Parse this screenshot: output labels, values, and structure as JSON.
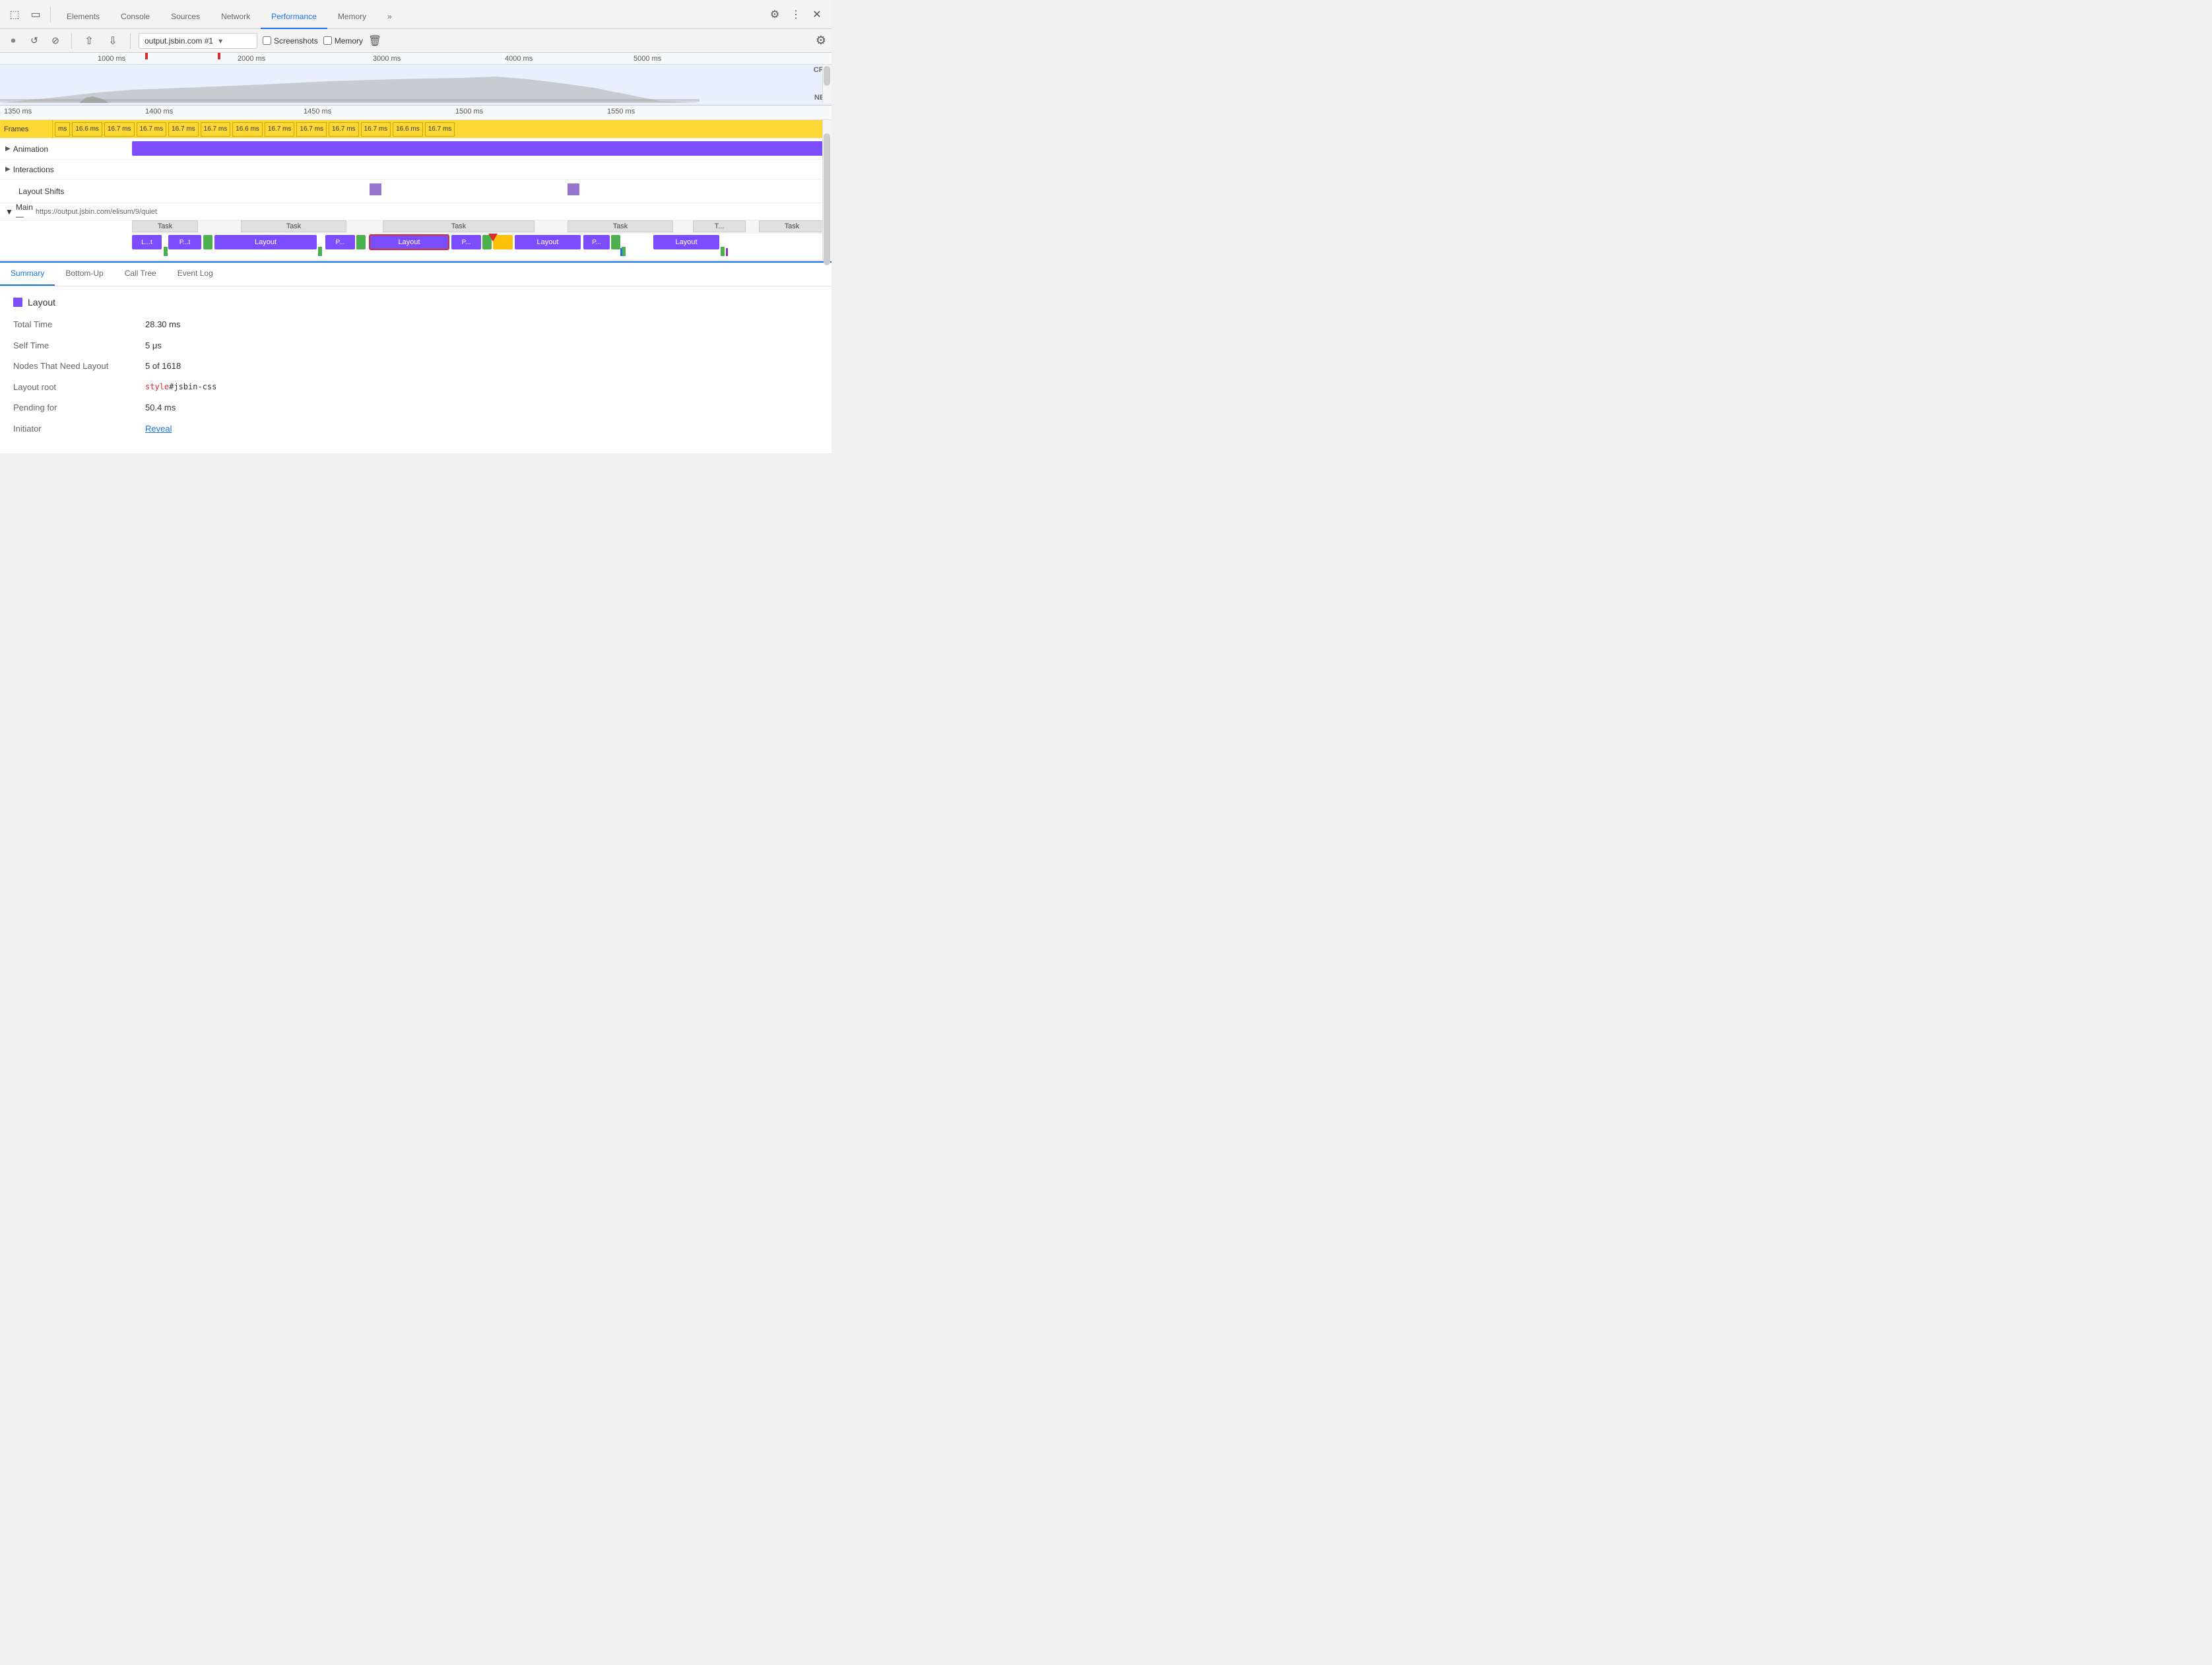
{
  "tabs": {
    "items": [
      {
        "label": "Elements",
        "active": false
      },
      {
        "label": "Console",
        "active": false
      },
      {
        "label": "Sources",
        "active": false
      },
      {
        "label": "Network",
        "active": false
      },
      {
        "label": "Performance",
        "active": true
      },
      {
        "label": "Memory",
        "active": false
      },
      {
        "label": "»",
        "active": false
      }
    ]
  },
  "record_bar": {
    "url": "output.jsbin.com #1",
    "screenshots_label": "Screenshots",
    "memory_label": "Memory"
  },
  "overview": {
    "time_markers": [
      "1000 ms",
      "2000 ms",
      "3000 ms",
      "4000 ms",
      "5000 ms"
    ],
    "cpu_label": "CPU",
    "net_label": "NET"
  },
  "detail": {
    "time_markers": [
      "1350 ms",
      "1400 ms",
      "1450 ms",
      "1500 ms",
      "1550 ms"
    ],
    "frames_label": "Frames",
    "frame_chips": [
      "ms",
      "16.6 ms",
      "16.7 ms",
      "16.7 ms",
      "16.7 ms",
      "16.7 ms",
      "16.6 ms",
      "16.7 ms",
      "16.7 ms",
      "16.7 ms",
      "16.7 ms",
      "16.6 ms",
      "16.7 ms"
    ],
    "animation_label": "Animation",
    "interactions_label": "Interactions",
    "layout_shifts_label": "Layout Shifts",
    "main_label": "Main",
    "main_url": "https://output.jsbin.com/elisum/9/quiet"
  },
  "tasks": {
    "task_label": "Task",
    "t_label": "T...",
    "blocks": [
      {
        "label": "L...t",
        "type": "purple"
      },
      {
        "label": "P...t",
        "type": "purple"
      },
      {
        "label": "Layout",
        "type": "purple"
      },
      {
        "label": "P...",
        "type": "purple"
      },
      {
        "label": "Layout",
        "type": "purple",
        "selected": true
      },
      {
        "label": "P...",
        "type": "purple"
      },
      {
        "label": "Layout",
        "type": "purple"
      },
      {
        "label": "P...",
        "type": "purple"
      },
      {
        "label": "Layout",
        "type": "purple"
      }
    ]
  },
  "bottom_tabs": [
    "Summary",
    "Bottom-Up",
    "Call Tree",
    "Event Log"
  ],
  "summary": {
    "title": "Layout",
    "fields": [
      {
        "label": "Total Time",
        "value": "28.30 ms"
      },
      {
        "label": "Self Time",
        "value": "5 μs"
      },
      {
        "label": "Nodes That Need Layout",
        "value": "5 of 1618"
      },
      {
        "label": "Layout root",
        "value_html": true,
        "red_part": "style",
        "black_part": "#jsbin-css"
      },
      {
        "label": "Pending for",
        "value": "50.4 ms"
      },
      {
        "label": "Initiator",
        "value": "Reveal",
        "is_link": true
      }
    ]
  }
}
